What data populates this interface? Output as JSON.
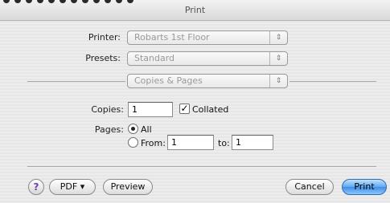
{
  "window": {
    "title": "Print"
  },
  "printer": {
    "label": "Printer:",
    "value": "Robarts 1st Floor"
  },
  "presets": {
    "label": "Presets:",
    "value": "Standard"
  },
  "pane": {
    "value": "Copies & Pages"
  },
  "copies": {
    "label": "Copies:",
    "value": "1",
    "collated_label": "Collated",
    "collated_checked": true
  },
  "pages": {
    "label": "Pages:",
    "all_label": "All",
    "from_label": "From:",
    "from_value": "1",
    "to_label": "to:",
    "to_value": "1",
    "selected": "All"
  },
  "buttons": {
    "help": "?",
    "pdf": "PDF ▾",
    "preview": "Preview",
    "cancel": "Cancel",
    "print": "Print"
  },
  "icons": {
    "popup_arrows": "⇕",
    "check": "✓"
  },
  "colors": {
    "default_button": "#3f8ee6",
    "background": "#e9e9e9"
  }
}
